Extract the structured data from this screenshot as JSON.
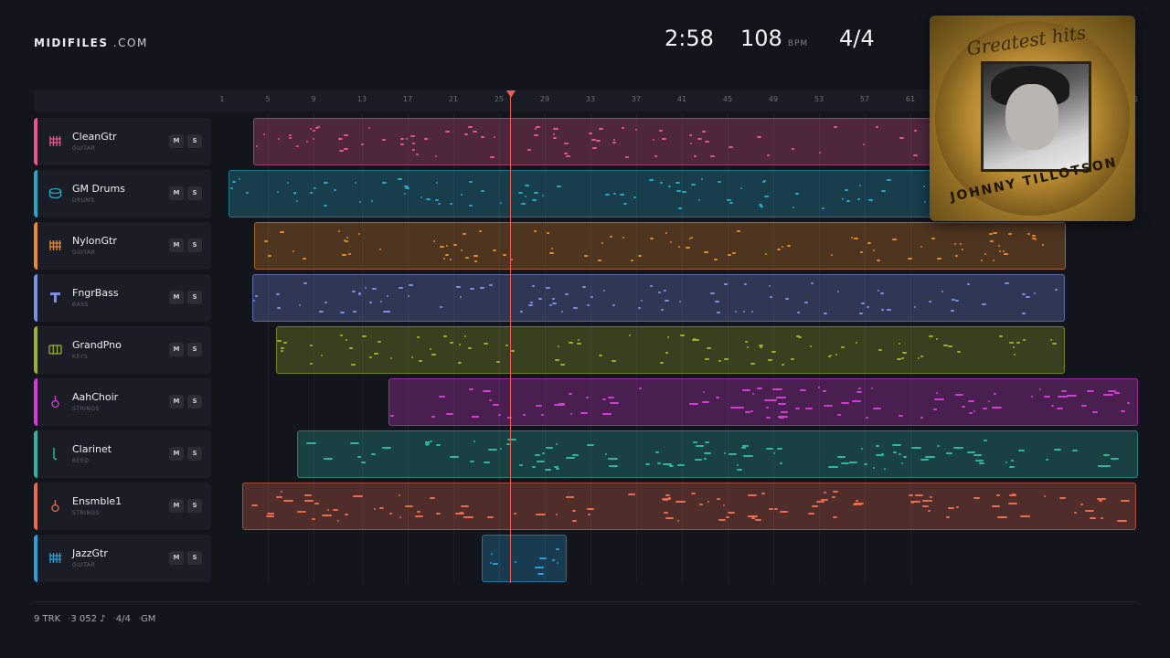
{
  "brand": {
    "name": "MIDIFILES",
    "suffix": " .COM"
  },
  "transport": {
    "time": "2:58",
    "bpm": "108",
    "bpm_unit": "BPM",
    "signature": "4/4"
  },
  "ruler": {
    "ticks": [
      "1",
      "5",
      "9",
      "13",
      "17",
      "21",
      "25",
      "29",
      "33",
      "37",
      "41",
      "45",
      "49",
      "53",
      "57",
      "61",
      "1"
    ]
  },
  "tracks": [
    {
      "name": "CleanGtr",
      "category": "GUITAR",
      "color": "#e8558f",
      "icon": "guitar-icon",
      "mute": "M",
      "solo": "S"
    },
    {
      "name": "GM Drums",
      "category": "DRUMS",
      "color": "#27a7c6",
      "icon": "drum-icon",
      "mute": "M",
      "solo": "S"
    },
    {
      "name": "NylonGtr",
      "category": "GUITAR",
      "color": "#e8892a",
      "icon": "guitar-icon",
      "mute": "M",
      "solo": "S"
    },
    {
      "name": "FngrBass",
      "category": "BASS",
      "color": "#7b8fe6",
      "icon": "bass-icon",
      "mute": "M",
      "solo": "S"
    },
    {
      "name": "GrandPno",
      "category": "KEYS",
      "color": "#9cb12a",
      "icon": "piano-icon",
      "mute": "M",
      "solo": "S"
    },
    {
      "name": "AahChoir",
      "category": "STRINGS",
      "color": "#d63ad6",
      "icon": "violin-icon",
      "mute": "M",
      "solo": "S"
    },
    {
      "name": "Clarinet",
      "category": "REED",
      "color": "#2fb5a0",
      "icon": "clarinet-icon",
      "mute": "M",
      "solo": "S"
    },
    {
      "name": "Ensmble1",
      "category": "STRINGS",
      "color": "#ec6a4e",
      "icon": "violin-icon",
      "mute": "M",
      "solo": "S"
    },
    {
      "name": "JazzGtr",
      "category": "GUITAR",
      "color": "#2b9fd8",
      "icon": "guitar-icon",
      "mute": "M",
      "solo": "S"
    }
  ],
  "album": {
    "title": "Greatest hits",
    "artist": "JOHNNY TILLOTSON"
  },
  "footer": {
    "tracks": "9 TRK",
    "notes": "3 052 ♪",
    "signature": "4/4",
    "standard": "GM"
  }
}
